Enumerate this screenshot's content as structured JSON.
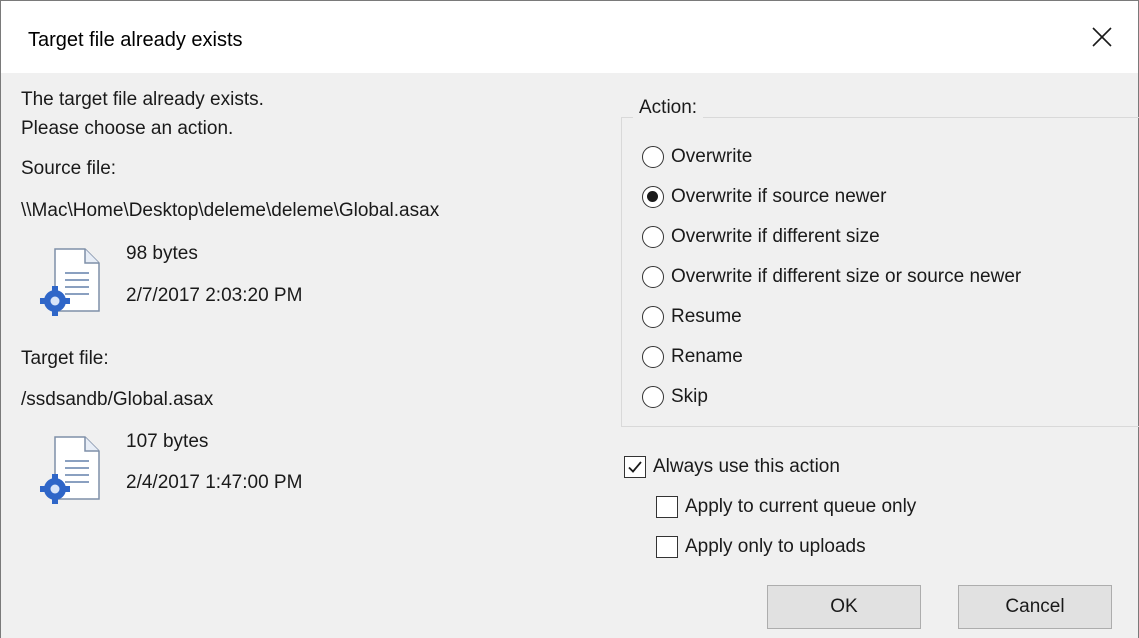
{
  "window": {
    "title": "Target file already exists",
    "close_icon": "close-icon"
  },
  "message": {
    "line1": "The target file already exists.",
    "line2": "Please choose an action."
  },
  "source": {
    "label": "Source file:",
    "path": "\\\\Mac\\Home\\Desktop\\deleme\\deleme\\Global.asax",
    "size": "98 bytes",
    "modified": "2/7/2017 2:03:20 PM",
    "icon": "script-file-icon"
  },
  "target": {
    "label": "Target file:",
    "path": "/ssdsandb/Global.asax",
    "size": "107 bytes",
    "modified": "2/4/2017 1:47:00 PM",
    "icon": "script-file-icon"
  },
  "action": {
    "label": "Action:",
    "selected": "Overwrite if source newer",
    "options": [
      "Overwrite",
      "Overwrite if source newer",
      "Overwrite if different size",
      "Overwrite if different size or source newer",
      "Resume",
      "Rename",
      "Skip"
    ]
  },
  "checkboxes": {
    "always": {
      "label": "Always use this action",
      "checked": true
    },
    "current_queue": {
      "label": "Apply to current queue only",
      "checked": false
    },
    "uploads_only": {
      "label": "Apply only to uploads",
      "checked": false
    }
  },
  "buttons": {
    "ok": "OK",
    "cancel": "Cancel"
  },
  "colors": {
    "dialog_bg": "#f0f0f0",
    "titlebar_bg": "#ffffff",
    "button_bg": "#e1e1e1",
    "icon_blue": "#2f66c8"
  }
}
